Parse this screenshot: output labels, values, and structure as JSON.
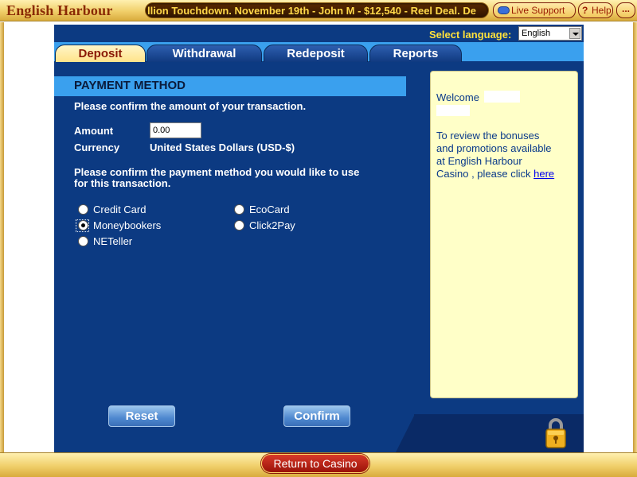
{
  "topbar": {
    "brand": "English Harbour",
    "ticker": "llion Touchdown. November 19th - John M - $12,540 - Reel Deal. De",
    "live_support": "Live Support",
    "help": "Help",
    "help_mark": "?",
    "minimize": "..."
  },
  "language": {
    "label": "Select language:",
    "selected": "English"
  },
  "tabs": [
    {
      "label": "Deposit",
      "active": true
    },
    {
      "label": "Withdrawal",
      "active": false
    },
    {
      "label": "Redeposit",
      "active": false
    },
    {
      "label": "Reports",
      "active": false
    }
  ],
  "form": {
    "section_title": "PAYMENT METHOD",
    "confirm_amount_text": "Please confirm the amount of your transaction.",
    "amount_label": "Amount",
    "amount_value": "0.00",
    "currency_label": "Currency",
    "currency_value": "United States Dollars (USD-$)",
    "confirm_method_text_1": "Please confirm the payment method you would like to use",
    "confirm_method_text_2": "for this transaction.",
    "methods": [
      {
        "label": "Credit Card",
        "selected": false
      },
      {
        "label": "Moneybookers",
        "selected": true
      },
      {
        "label": "NETeller",
        "selected": false
      },
      {
        "label": "EcoCard",
        "selected": false
      },
      {
        "label": "Click2Pay",
        "selected": false
      }
    ]
  },
  "buttons": {
    "reset": "Reset",
    "confirm": "Confirm",
    "return": "Return to Casino"
  },
  "welcome": {
    "welcome": "Welcome",
    "line1": "To review the bonuses",
    "line2": "and promotions available",
    "line3": "at English Harbour",
    "line4": "Casino , please click",
    "link": "here"
  },
  "colors": {
    "panel": "#0c3a82",
    "accent_blue": "#3aa0ee",
    "gold": "#f0cf6a",
    "language_label": "#ffe13a",
    "welcome_bg": "#ffffc8"
  },
  "icons": [
    "chat-bubble-icon",
    "help-icon",
    "padlock-icon",
    "dropdown-arrow-icon"
  ]
}
